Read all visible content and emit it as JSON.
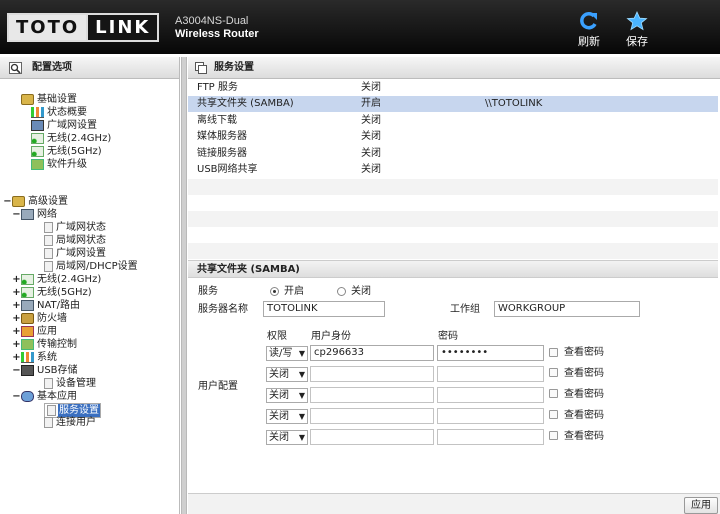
{
  "header": {
    "logo_left": "TOTO",
    "logo_right": "LINK",
    "model": "A3004NS-Dual",
    "product": "Wireless Router",
    "refresh_label": "刷新",
    "save_label": "保存"
  },
  "left_panel": {
    "title": "配置选项",
    "tree": {
      "basic": "基础设置",
      "status": "状态概要",
      "wan": "广域网设置",
      "wifi24": "无线(2.4GHz)",
      "wifi5": "无线(5GHz)",
      "upgrade": "软件升级",
      "advanced": "高级设置",
      "network": "网络",
      "wan_status": "广域网状态",
      "lan_status": "局域网状态",
      "wan_set": "广域网设置",
      "lan_dhcp": "局域网/DHCP设置",
      "adv_wifi24": "无线(2.4GHz)",
      "adv_wifi5": "无线(5GHz)",
      "nat": "NAT/路由",
      "firewall": "防火墙",
      "apps": "应用",
      "qos": "传输控制",
      "system": "系统",
      "usb": "USB存储",
      "device_mgmt": "设备管理",
      "basic_apps": "基本应用",
      "service_settings": "服务设置",
      "connected_users": "连接用户"
    }
  },
  "right_panel": {
    "title": "服务设置",
    "services": [
      {
        "name": "FTP 服务",
        "status": "关闭",
        "extra": ""
      },
      {
        "name": "共享文件夹 (SAMBA)",
        "status": "开启",
        "extra": "\\\\TOTOLINK"
      },
      {
        "name": "离线下载",
        "status": "关闭",
        "extra": ""
      },
      {
        "name": "媒体服务器",
        "status": "关闭",
        "extra": ""
      },
      {
        "name": "链接服务器",
        "status": "关闭",
        "extra": ""
      },
      {
        "name": "USB网络共享",
        "status": "关闭",
        "extra": ""
      }
    ],
    "samba": {
      "title": "共享文件夹 (SAMBA)",
      "service_label": "服务",
      "on_label": "开启",
      "off_label": "关闭",
      "server_name_label": "服务器名称",
      "server_name": "TOTOLINK",
      "workgroup_label": "工作组",
      "workgroup": "WORKGROUP",
      "user_config_label": "用户配置",
      "col_perm": "权限",
      "col_user": "用户身份",
      "col_pass": "密码",
      "show_pass_label": "查看密码",
      "users": [
        {
          "perm": "读/写",
          "user": "cp296633",
          "pass": "••••••••"
        },
        {
          "perm": "关闭",
          "user": "",
          "pass": ""
        },
        {
          "perm": "关闭",
          "user": "",
          "pass": ""
        },
        {
          "perm": "关闭",
          "user": "",
          "pass": ""
        },
        {
          "perm": "关闭",
          "user": "",
          "pass": ""
        }
      ]
    },
    "apply_label": "应用"
  },
  "colors": {
    "header_bg": "#070707",
    "selected_row": "#c7d6ee",
    "tree_selection": "#3a6fc0"
  }
}
